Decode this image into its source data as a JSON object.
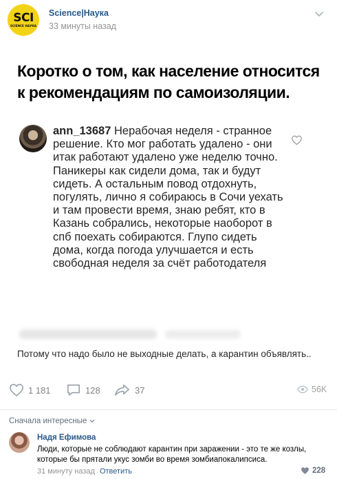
{
  "post": {
    "channel_avatar_text": "SCI",
    "channel_avatar_subtext": "SCIENCE НАУКА",
    "channel_name": "Science|Наука",
    "time": "33 минуты назад",
    "headline": "Коротко о том, как население относится к рекомендациям по самоизоляции."
  },
  "insta_comment": {
    "username": "ann_13687",
    "text": " Нерабочая неделя - странное решение. Кто мог работать удалено - они итак работают удалено уже неделю точно. Паникеры как сидели дома, так и будут сидеть. А остальным повод отдохнуть, погулять, лично я собираюсь в Сочи уехать и там провести время, знаю ребят, кто в Казань собрались, некоторые наоборот в спб поехать собираются. Глупо сидеть дома, когда погода улучшается и есть свободная неделя за счёт работодателя",
    "reply_text": "Потому что надо было не выходные делать, а карантин объявлять.."
  },
  "actions": {
    "likes": "1 181",
    "comments": "128",
    "shares": "37",
    "views": "56K"
  },
  "comments": {
    "sort_label": "Сначала интересные",
    "items": [
      {
        "author": "Надя Ефимова",
        "text": "Люди, которые не соблюдают карантин при заражении - это те же козлы, которые бы прятали укус зомби во время зомбиапокалипсиса.",
        "time": "31 минуту назад",
        "reply_label": "Ответить",
        "likes": "228"
      }
    ]
  },
  "colors": {
    "link": "#2a5885",
    "muted": "#939393",
    "avatar_yellow": "#f2d318"
  }
}
